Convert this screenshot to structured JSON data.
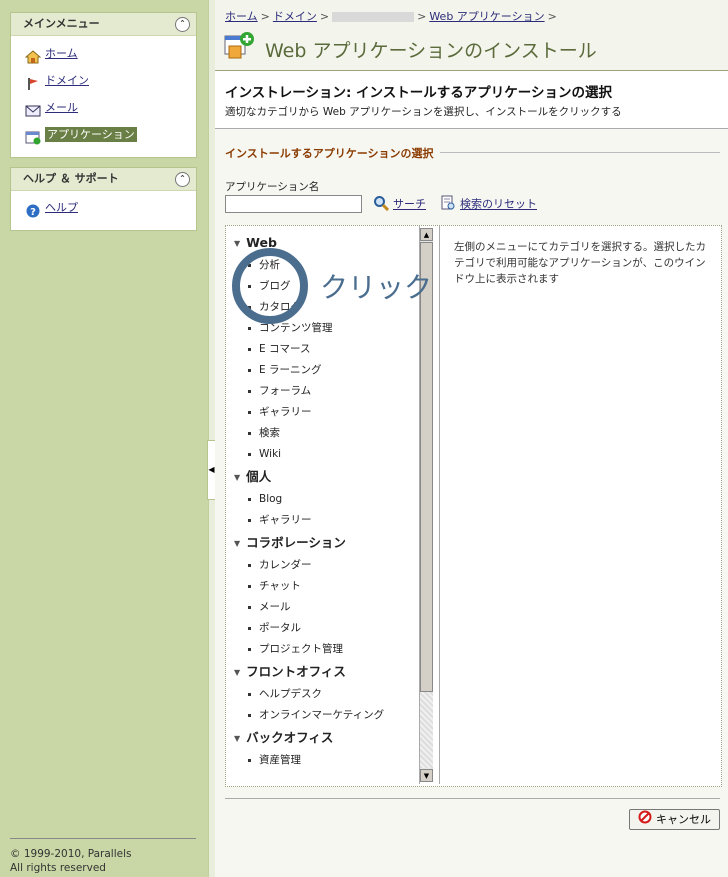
{
  "sidebar": {
    "main_menu": {
      "title": "メインメニュー",
      "items": [
        {
          "label": "ホーム",
          "icon": "home-icon"
        },
        {
          "label": "ドメイン",
          "icon": "domain-icon"
        },
        {
          "label": "メール",
          "icon": "mail-icon"
        },
        {
          "label": "アプリケーション",
          "icon": "application-icon",
          "active": true
        }
      ]
    },
    "help_menu": {
      "title": "ヘルプ ＆ サポート",
      "items": [
        {
          "label": "ヘルプ",
          "icon": "help-icon"
        }
      ]
    },
    "copyright_line1": "© 1999-2010, Parallels",
    "copyright_line2": "All rights reserved"
  },
  "header": {
    "breadcrumb": {
      "home": "ホーム",
      "sep": ">",
      "domain": "ドメイン",
      "webapps": "Web アプリケーション"
    },
    "title_prefix": "Web",
    "title_rest": " アプリケーションのインストール"
  },
  "subheader": {
    "title": "インストレーション: インストールするアプリケーションの選択",
    "desc": "適切なカテゴリから Web アプリケーションを選択し、インストールをクリックする"
  },
  "form": {
    "legend": "インストールするアプリケーションの選択",
    "field_label": "アプリケーション名",
    "search_value": "",
    "search_label": "サーチ",
    "reset_label": "検索のリセット"
  },
  "categories": [
    {
      "name": "Web",
      "items": [
        "分析",
        "ブログ",
        "カタログ",
        "コンテンツ管理",
        "E コマース",
        "E ラーニング",
        "フォーラム",
        "ギャラリー",
        "検索",
        "Wiki"
      ]
    },
    {
      "name": "個人",
      "items": [
        "Blog",
        "ギャラリー"
      ]
    },
    {
      "name": "コラボレーション",
      "items": [
        "カレンダー",
        "チャット",
        "メール",
        "ポータル",
        "プロジェクト管理"
      ]
    },
    {
      "name": "フロントオフィス",
      "items": [
        "ヘルプデスク",
        "オンラインマーケティング"
      ]
    },
    {
      "name": "バックオフィス",
      "items": [
        "資産管理"
      ]
    }
  ],
  "info_text": "左側のメニューにてカテゴリを選択する。選択したカテゴリで利用可能なアプリケーションが、このウインドウ上に表示されます",
  "annotation": {
    "label": "クリック",
    "color": "#4b6e8f"
  },
  "cancel_label": "キャンセル",
  "colors": {
    "sidebar_bg": "#c9d7a6",
    "active_item": "#6a7f45",
    "legend": "#8a3b00",
    "title": "#5a6a3a"
  }
}
